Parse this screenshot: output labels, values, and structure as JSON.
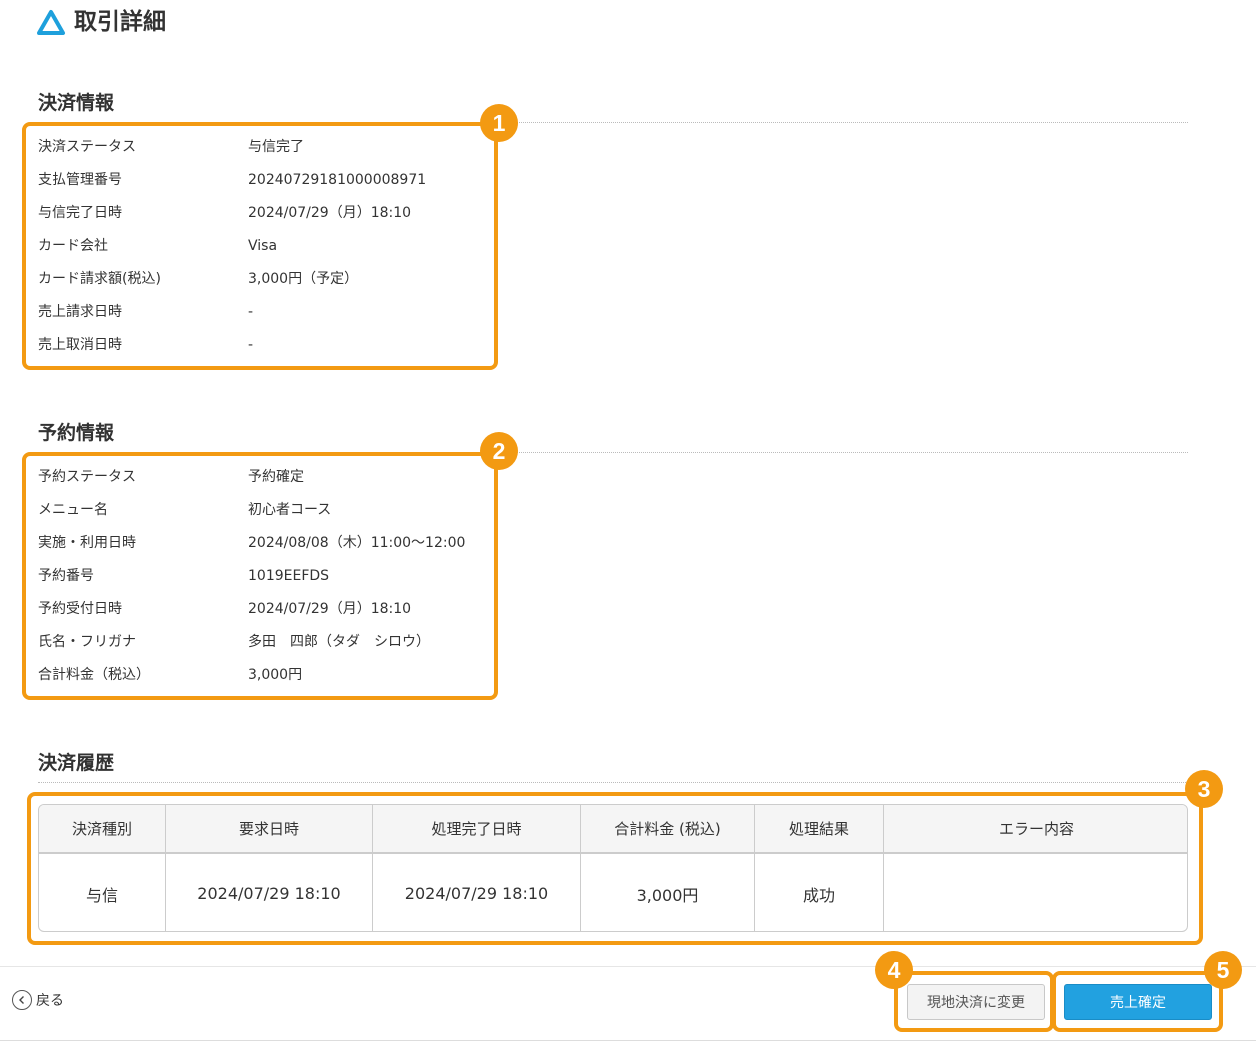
{
  "header": {
    "title": "取引詳細",
    "logo_icon": "delta-logo-icon"
  },
  "payment_info": {
    "title": "決済情報",
    "rows": [
      {
        "label": "決済ステータス",
        "value": "与信完了"
      },
      {
        "label": "支払管理番号",
        "value": "20240729181000008971"
      },
      {
        "label": "与信完了日時",
        "value": "2024/07/29（月）18:10"
      },
      {
        "label": "カード会社",
        "value": "Visa"
      },
      {
        "label": "カード請求額(税込)",
        "value": "3,000円（予定）"
      },
      {
        "label": "売上請求日時",
        "value": "-"
      },
      {
        "label": "売上取消日時",
        "value": "-"
      }
    ]
  },
  "reservation_info": {
    "title": "予約情報",
    "rows": [
      {
        "label": "予約ステータス",
        "value": "予約確定"
      },
      {
        "label": "メニュー名",
        "value": "初心者コース"
      },
      {
        "label": "実施・利用日時",
        "value": "2024/08/08（木）11:00〜12:00"
      },
      {
        "label": "予約番号",
        "value": "1019EEFDS"
      },
      {
        "label": "予約受付日時",
        "value": "2024/07/29（月）18:10"
      },
      {
        "label": "氏名・フリガナ",
        "value": "多田　四郎（タダ　シロウ）"
      },
      {
        "label": "合計料金（税込）",
        "value": "3,000円"
      }
    ]
  },
  "payment_history": {
    "title": "決済履歴",
    "columns": [
      "決済種別",
      "要求日時",
      "処理完了日時",
      "合計料金 (税込)",
      "処理結果",
      "エラー内容"
    ],
    "rows": [
      [
        "与信",
        "2024/07/29 18:10",
        "2024/07/29 18:10",
        "3,000円",
        "成功",
        ""
      ]
    ]
  },
  "footer": {
    "back_label": "戻る",
    "onsite_button": "現地決済に変更",
    "confirm_button": "売上確定"
  },
  "callouts": [
    "1",
    "2",
    "3",
    "4",
    "5"
  ],
  "colors": {
    "callout": "#f39a12",
    "primary_button": "#22a1e0",
    "logo": "#1ea0dc"
  }
}
